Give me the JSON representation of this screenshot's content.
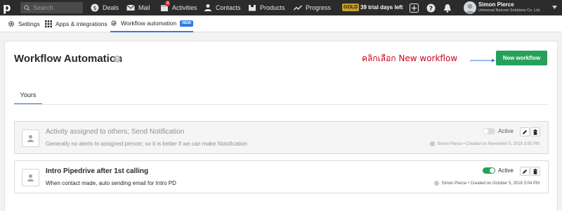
{
  "topnav": {
    "logo": "p",
    "search_placeholder": "Search",
    "items": [
      {
        "label": "Deals",
        "icon": "dollar-icon"
      },
      {
        "label": "Mail",
        "icon": "mail-icon"
      },
      {
        "label": "Activities",
        "icon": "calendar-icon",
        "badge": "4"
      },
      {
        "label": "Contacts",
        "icon": "person-icon"
      },
      {
        "label": "Products",
        "icon": "box-icon"
      },
      {
        "label": "Progress",
        "icon": "trend-icon"
      }
    ],
    "plan_badge": "GOLD",
    "trial_text": "39 trial days left",
    "user": {
      "name": "Simon Pierce",
      "company": "Universal Netcom Solutions Co. Ltd."
    }
  },
  "subnav": {
    "items": [
      {
        "label": "Settings",
        "icon": "gear-icon"
      },
      {
        "label": "Apps & integrations",
        "icon": "grid-icon"
      },
      {
        "label": "Workflow automation",
        "icon": "workflow-icon",
        "badge": "NEW",
        "active": true
      }
    ]
  },
  "page": {
    "title": "Workflow Automation",
    "annotation": "คลิกเลือก New workflow",
    "new_button": "New workflow",
    "tab": "Yours"
  },
  "workflows": [
    {
      "title": "Activity assigned to others; Send Notification",
      "description": "Generally no alerts to assigned person; so it is better if we can make Notofication",
      "status_label": "Active",
      "active": false,
      "meta": "Simon Pierce • Created on November 5, 2018 3:55 PM"
    },
    {
      "title": "Intro Pipedrive after 1st calling",
      "description": "When contact made, auto sending email for Intro PD",
      "status_label": "Active",
      "active": true,
      "meta": "Simon Pierce • Created on October 5, 2018 3:04 PM"
    }
  ],
  "colors": {
    "accent": "#317ae2",
    "green": "#25a15a",
    "topbar": "#2b2b2b",
    "annotation": "#d0021b"
  }
}
